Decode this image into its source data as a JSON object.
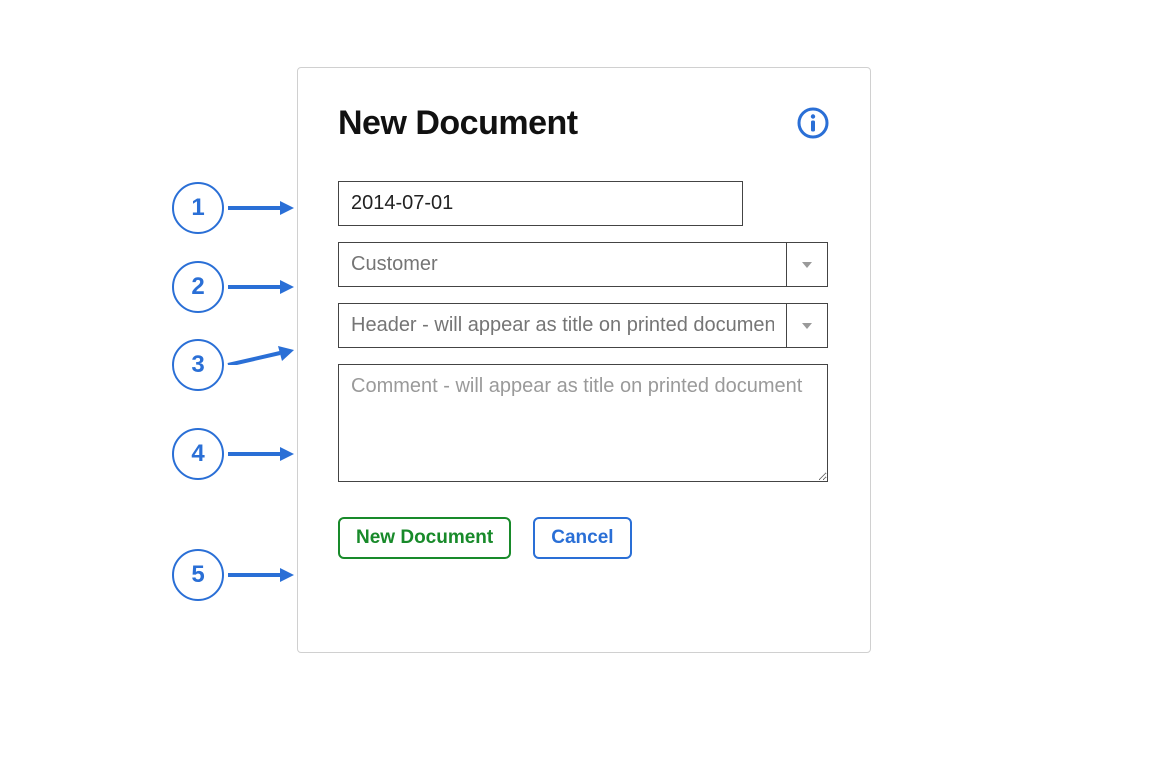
{
  "dialog": {
    "title": "New Document",
    "info_tooltip": "Info"
  },
  "fields": {
    "date": {
      "value": "2014-07-01",
      "placeholder": ""
    },
    "customer": {
      "value": "",
      "placeholder": "Customer"
    },
    "header": {
      "value": "",
      "placeholder": "Header - will appear as title on printed document"
    },
    "comment": {
      "value": "",
      "placeholder": "Comment - will appear as title on printed document"
    }
  },
  "buttons": {
    "primary": "New Document",
    "secondary": "Cancel"
  },
  "callouts": {
    "c1": "1",
    "c2": "2",
    "c3": "3",
    "c4": "4",
    "c5": "5"
  }
}
